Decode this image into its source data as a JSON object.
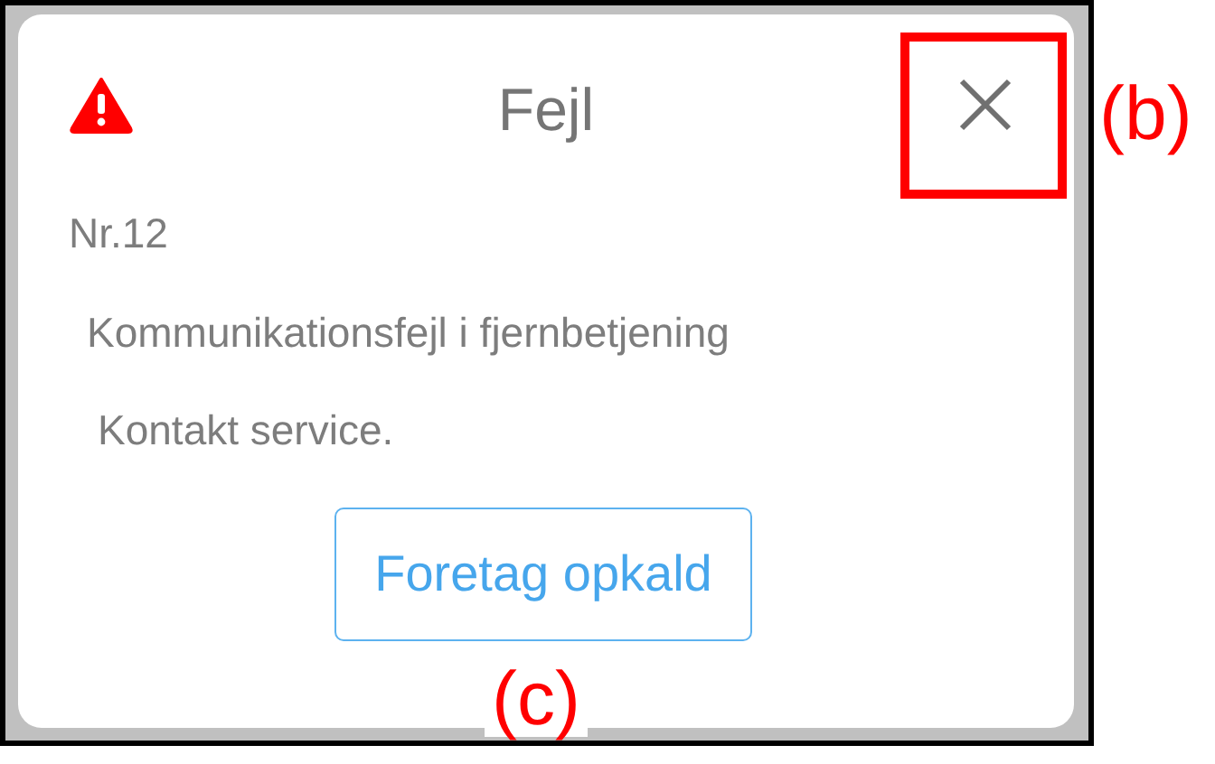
{
  "dialog": {
    "title": "Fejl",
    "code": "Nr.12",
    "message": "Kommunikationsfejl i fjernbetjening",
    "note": "Kontakt service.",
    "button": "Foretag opkald"
  },
  "annotations": [
    {
      "label": "(b)",
      "kind": "box"
    },
    {
      "label": "(c)",
      "kind": "plain"
    }
  ]
}
